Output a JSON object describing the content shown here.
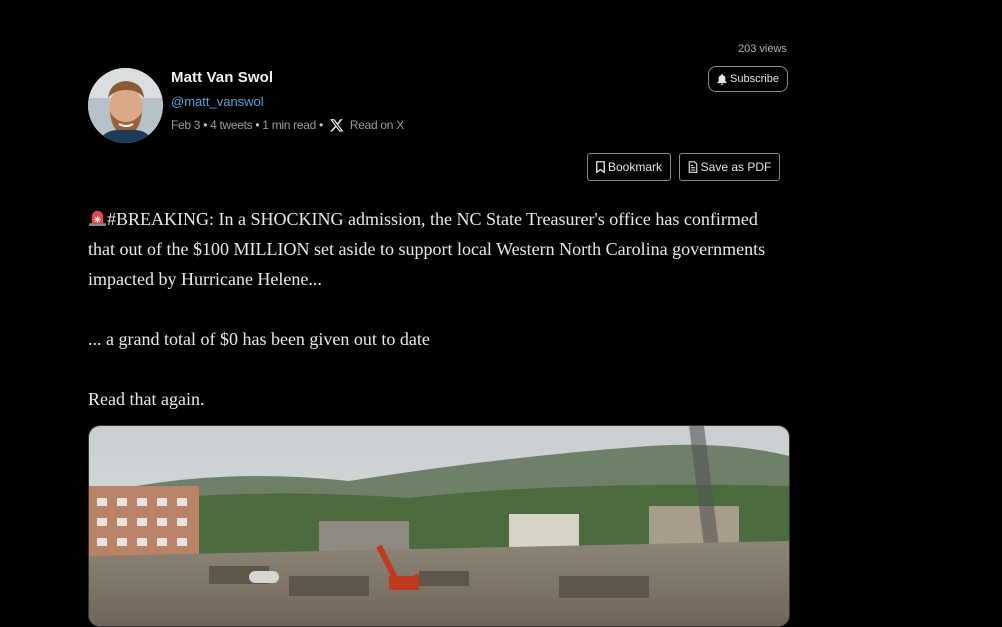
{
  "header": {
    "views": "203 views",
    "author_name": "Matt Van Swol",
    "author_handle": "@matt_vanswol",
    "date": "Feb 3",
    "tweets": "4 tweets",
    "read_time": "1 min read",
    "read_on": "Read on X",
    "subscribe_label": "Subscribe"
  },
  "actions": {
    "bookmark_label": "Bookmark",
    "save_pdf_label": "Save as PDF"
  },
  "tweet": {
    "emoji": "police-light-emoji",
    "paragraph1": "#BREAKING: In a SHOCKING admission, the NC State Treasurer's office has confirmed that out of the $100 MILLION set aside to support local Western North Carolina governments impacted by Hurricane Helene...",
    "paragraph2": "... a grand total of $0 has been given out to date",
    "paragraph3": "Read that again."
  },
  "media": {
    "image_alt": "hurricane-damage-photo"
  },
  "colors": {
    "background": "#000000",
    "handle": "#4aa3df",
    "text": "#e9e9e9"
  }
}
